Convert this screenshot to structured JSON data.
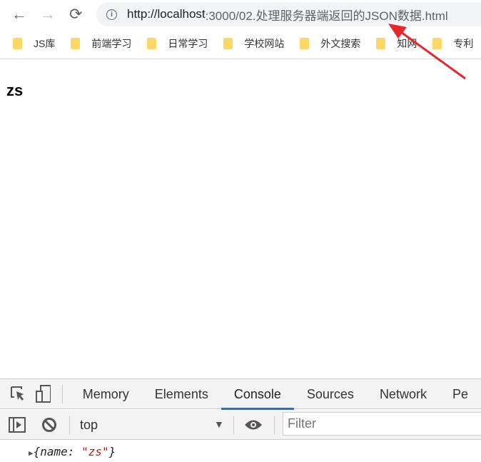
{
  "browser": {
    "url_host": "http://localhost",
    "url_path": ":3000/02.处理服务器端返回的JSON数据.html",
    "bookmarks": [
      "JS库",
      "前端学习",
      "日常学习",
      "学校网站",
      "外文搜索",
      "知网",
      "专利"
    ]
  },
  "page": {
    "text": "zs"
  },
  "devtools": {
    "tabs": [
      "Memory",
      "Elements",
      "Console",
      "Sources",
      "Network",
      "Pe"
    ],
    "active_tab": "Console",
    "context": "top",
    "filter_placeholder": "Filter",
    "log": {
      "open": "{",
      "key": "name",
      "colon": ": ",
      "value": "\"zs\"",
      "close": "}"
    }
  },
  "colors": {
    "accent": "#1a73e8",
    "annotation_arrow": "#e8262b",
    "folder": "#fbd865"
  }
}
